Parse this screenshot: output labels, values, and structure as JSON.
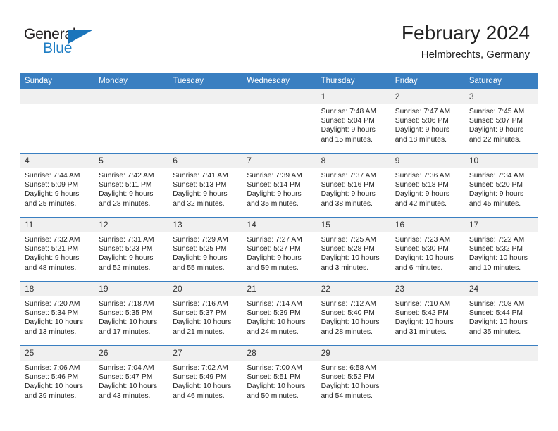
{
  "brand": {
    "name_part1": "General",
    "name_part2": "Blue",
    "triangle_icon": "triangle-icon",
    "accent_color": "#1b75bb"
  },
  "header": {
    "title": "February 2024",
    "subtitle": "Helmbrechts, Germany"
  },
  "colors": {
    "header_band": "#3a7fc1",
    "daynum_band": "#f0f0f0",
    "text": "#222222"
  },
  "weekday_headers": [
    "Sunday",
    "Monday",
    "Tuesday",
    "Wednesday",
    "Thursday",
    "Friday",
    "Saturday"
  ],
  "weeks": [
    [
      {
        "day": "",
        "empty": true,
        "sunrise": "",
        "sunset": "",
        "daylight_line1": "",
        "daylight_line2": ""
      },
      {
        "day": "",
        "empty": true,
        "sunrise": "",
        "sunset": "",
        "daylight_line1": "",
        "daylight_line2": ""
      },
      {
        "day": "",
        "empty": true,
        "sunrise": "",
        "sunset": "",
        "daylight_line1": "",
        "daylight_line2": ""
      },
      {
        "day": "",
        "empty": true,
        "sunrise": "",
        "sunset": "",
        "daylight_line1": "",
        "daylight_line2": ""
      },
      {
        "day": "1",
        "sunrise": "Sunrise: 7:48 AM",
        "sunset": "Sunset: 5:04 PM",
        "daylight_line1": "Daylight: 9 hours",
        "daylight_line2": "and 15 minutes."
      },
      {
        "day": "2",
        "sunrise": "Sunrise: 7:47 AM",
        "sunset": "Sunset: 5:06 PM",
        "daylight_line1": "Daylight: 9 hours",
        "daylight_line2": "and 18 minutes."
      },
      {
        "day": "3",
        "sunrise": "Sunrise: 7:45 AM",
        "sunset": "Sunset: 5:07 PM",
        "daylight_line1": "Daylight: 9 hours",
        "daylight_line2": "and 22 minutes."
      }
    ],
    [
      {
        "day": "4",
        "sunrise": "Sunrise: 7:44 AM",
        "sunset": "Sunset: 5:09 PM",
        "daylight_line1": "Daylight: 9 hours",
        "daylight_line2": "and 25 minutes."
      },
      {
        "day": "5",
        "sunrise": "Sunrise: 7:42 AM",
        "sunset": "Sunset: 5:11 PM",
        "daylight_line1": "Daylight: 9 hours",
        "daylight_line2": "and 28 minutes."
      },
      {
        "day": "6",
        "sunrise": "Sunrise: 7:41 AM",
        "sunset": "Sunset: 5:13 PM",
        "daylight_line1": "Daylight: 9 hours",
        "daylight_line2": "and 32 minutes."
      },
      {
        "day": "7",
        "sunrise": "Sunrise: 7:39 AM",
        "sunset": "Sunset: 5:14 PM",
        "daylight_line1": "Daylight: 9 hours",
        "daylight_line2": "and 35 minutes."
      },
      {
        "day": "8",
        "sunrise": "Sunrise: 7:37 AM",
        "sunset": "Sunset: 5:16 PM",
        "daylight_line1": "Daylight: 9 hours",
        "daylight_line2": "and 38 minutes."
      },
      {
        "day": "9",
        "sunrise": "Sunrise: 7:36 AM",
        "sunset": "Sunset: 5:18 PM",
        "daylight_line1": "Daylight: 9 hours",
        "daylight_line2": "and 42 minutes."
      },
      {
        "day": "10",
        "sunrise": "Sunrise: 7:34 AM",
        "sunset": "Sunset: 5:20 PM",
        "daylight_line1": "Daylight: 9 hours",
        "daylight_line2": "and 45 minutes."
      }
    ],
    [
      {
        "day": "11",
        "sunrise": "Sunrise: 7:32 AM",
        "sunset": "Sunset: 5:21 PM",
        "daylight_line1": "Daylight: 9 hours",
        "daylight_line2": "and 48 minutes."
      },
      {
        "day": "12",
        "sunrise": "Sunrise: 7:31 AM",
        "sunset": "Sunset: 5:23 PM",
        "daylight_line1": "Daylight: 9 hours",
        "daylight_line2": "and 52 minutes."
      },
      {
        "day": "13",
        "sunrise": "Sunrise: 7:29 AM",
        "sunset": "Sunset: 5:25 PM",
        "daylight_line1": "Daylight: 9 hours",
        "daylight_line2": "and 55 minutes."
      },
      {
        "day": "14",
        "sunrise": "Sunrise: 7:27 AM",
        "sunset": "Sunset: 5:27 PM",
        "daylight_line1": "Daylight: 9 hours",
        "daylight_line2": "and 59 minutes."
      },
      {
        "day": "15",
        "sunrise": "Sunrise: 7:25 AM",
        "sunset": "Sunset: 5:28 PM",
        "daylight_line1": "Daylight: 10 hours",
        "daylight_line2": "and 3 minutes."
      },
      {
        "day": "16",
        "sunrise": "Sunrise: 7:23 AM",
        "sunset": "Sunset: 5:30 PM",
        "daylight_line1": "Daylight: 10 hours",
        "daylight_line2": "and 6 minutes."
      },
      {
        "day": "17",
        "sunrise": "Sunrise: 7:22 AM",
        "sunset": "Sunset: 5:32 PM",
        "daylight_line1": "Daylight: 10 hours",
        "daylight_line2": "and 10 minutes."
      }
    ],
    [
      {
        "day": "18",
        "sunrise": "Sunrise: 7:20 AM",
        "sunset": "Sunset: 5:34 PM",
        "daylight_line1": "Daylight: 10 hours",
        "daylight_line2": "and 13 minutes."
      },
      {
        "day": "19",
        "sunrise": "Sunrise: 7:18 AM",
        "sunset": "Sunset: 5:35 PM",
        "daylight_line1": "Daylight: 10 hours",
        "daylight_line2": "and 17 minutes."
      },
      {
        "day": "20",
        "sunrise": "Sunrise: 7:16 AM",
        "sunset": "Sunset: 5:37 PM",
        "daylight_line1": "Daylight: 10 hours",
        "daylight_line2": "and 21 minutes."
      },
      {
        "day": "21",
        "sunrise": "Sunrise: 7:14 AM",
        "sunset": "Sunset: 5:39 PM",
        "daylight_line1": "Daylight: 10 hours",
        "daylight_line2": "and 24 minutes."
      },
      {
        "day": "22",
        "sunrise": "Sunrise: 7:12 AM",
        "sunset": "Sunset: 5:40 PM",
        "daylight_line1": "Daylight: 10 hours",
        "daylight_line2": "and 28 minutes."
      },
      {
        "day": "23",
        "sunrise": "Sunrise: 7:10 AM",
        "sunset": "Sunset: 5:42 PM",
        "daylight_line1": "Daylight: 10 hours",
        "daylight_line2": "and 31 minutes."
      },
      {
        "day": "24",
        "sunrise": "Sunrise: 7:08 AM",
        "sunset": "Sunset: 5:44 PM",
        "daylight_line1": "Daylight: 10 hours",
        "daylight_line2": "and 35 minutes."
      }
    ],
    [
      {
        "day": "25",
        "sunrise": "Sunrise: 7:06 AM",
        "sunset": "Sunset: 5:46 PM",
        "daylight_line1": "Daylight: 10 hours",
        "daylight_line2": "and 39 minutes."
      },
      {
        "day": "26",
        "sunrise": "Sunrise: 7:04 AM",
        "sunset": "Sunset: 5:47 PM",
        "daylight_line1": "Daylight: 10 hours",
        "daylight_line2": "and 43 minutes."
      },
      {
        "day": "27",
        "sunrise": "Sunrise: 7:02 AM",
        "sunset": "Sunset: 5:49 PM",
        "daylight_line1": "Daylight: 10 hours",
        "daylight_line2": "and 46 minutes."
      },
      {
        "day": "28",
        "sunrise": "Sunrise: 7:00 AM",
        "sunset": "Sunset: 5:51 PM",
        "daylight_line1": "Daylight: 10 hours",
        "daylight_line2": "and 50 minutes."
      },
      {
        "day": "29",
        "sunrise": "Sunrise: 6:58 AM",
        "sunset": "Sunset: 5:52 PM",
        "daylight_line1": "Daylight: 10 hours",
        "daylight_line2": "and 54 minutes."
      },
      {
        "day": "",
        "empty": true,
        "sunrise": "",
        "sunset": "",
        "daylight_line1": "",
        "daylight_line2": ""
      },
      {
        "day": "",
        "empty": true,
        "sunrise": "",
        "sunset": "",
        "daylight_line1": "",
        "daylight_line2": ""
      }
    ]
  ]
}
